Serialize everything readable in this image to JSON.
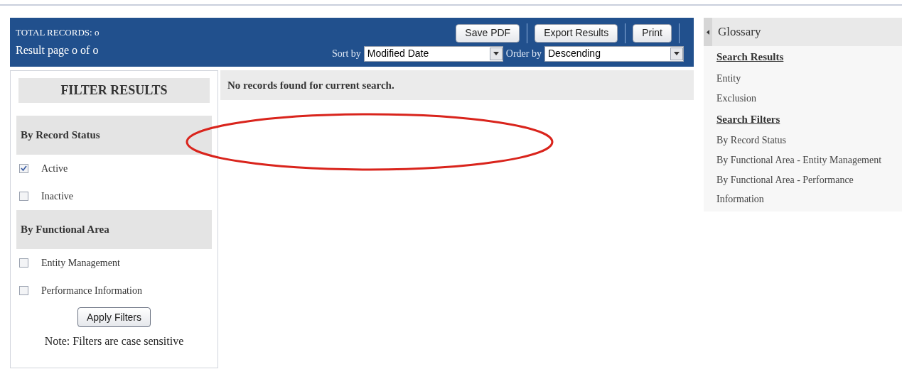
{
  "header": {
    "total_records": "TOTAL RECORDS: o",
    "result_page": "Result page o of o",
    "buttons": [
      "Save PDF",
      "Export Results",
      "Print"
    ],
    "sort": {
      "label": "Sort by",
      "value": "Modified Date"
    },
    "order": {
      "label": "Order by",
      "value": "Descending"
    }
  },
  "filters": {
    "title": "FILTER RESULTS",
    "groups": [
      {
        "title": "By Record Status",
        "options": [
          {
            "label": "Active",
            "checked": true
          },
          {
            "label": "Inactive",
            "checked": false
          }
        ]
      },
      {
        "title": "By Functional Area",
        "options": [
          {
            "label": "Entity Management",
            "checked": false
          },
          {
            "label": "Performance Information",
            "checked": false
          }
        ]
      }
    ],
    "apply_button": "Apply Filters",
    "note": "Note: Filters are case sensitive"
  },
  "results": {
    "message": "No records found for current search."
  },
  "glossary": {
    "title": "Glossary",
    "items": [
      {
        "kind": "heading",
        "text": "Search Results"
      },
      {
        "kind": "link",
        "text": "Entity"
      },
      {
        "kind": "link",
        "text": "Exclusion"
      },
      {
        "kind": "heading",
        "text": "Search Filters"
      },
      {
        "kind": "link",
        "text": "By Record Status"
      },
      {
        "kind": "link",
        "text": "By Functional Area - Entity Management"
      },
      {
        "kind": "link",
        "text": "By Functional Area - Performance Information"
      }
    ]
  }
}
